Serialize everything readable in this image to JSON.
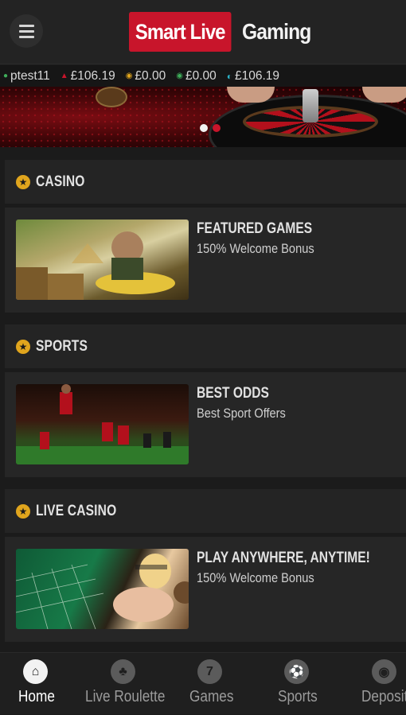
{
  "header": {
    "logo_part1": "Smart Live",
    "logo_part2": "Gaming"
  },
  "balances": [
    {
      "icon": "user-icon",
      "value": "ptest11",
      "color": "#3fae5a"
    },
    {
      "icon": "wallet-icon",
      "value": "£106.19",
      "color": "#c8152b"
    },
    {
      "icon": "bonus-icon",
      "value": "£0.00",
      "color": "#e0a51d"
    },
    {
      "icon": "cash-icon",
      "value": "£0.00",
      "color": "#3fae5a"
    },
    {
      "icon": "total-icon",
      "value": "£106.19",
      "color": "#2bb3c8"
    }
  ],
  "banner": {
    "slide_count": 2,
    "active_slide": 2
  },
  "sections": [
    {
      "title": "CASINO",
      "card_title": "FEATURED GAMES",
      "card_subtitle": "150% Welcome Bonus"
    },
    {
      "title": "SPORTS",
      "card_title": "BEST ODDS",
      "card_subtitle": "Best Sport Offers"
    },
    {
      "title": "LIVE CASINO",
      "card_title": "PLAY ANYWHERE, ANYTIME!",
      "card_subtitle": "150% Welcome Bonus"
    }
  ],
  "tabs": [
    {
      "label": "Home",
      "icon": "home-icon",
      "active": true
    },
    {
      "label": "Live Roulette",
      "icon": "club-icon",
      "active": false
    },
    {
      "label": "Games",
      "icon": "seven-icon",
      "active": false
    },
    {
      "label": "Sports",
      "icon": "soccer-ball-icon",
      "active": false
    },
    {
      "label": "Deposit",
      "icon": "coins-icon",
      "active": false
    }
  ],
  "colors": {
    "brand_red": "#c8152b",
    "accent_gold": "#e0a51d",
    "background": "#1b1b1b"
  }
}
